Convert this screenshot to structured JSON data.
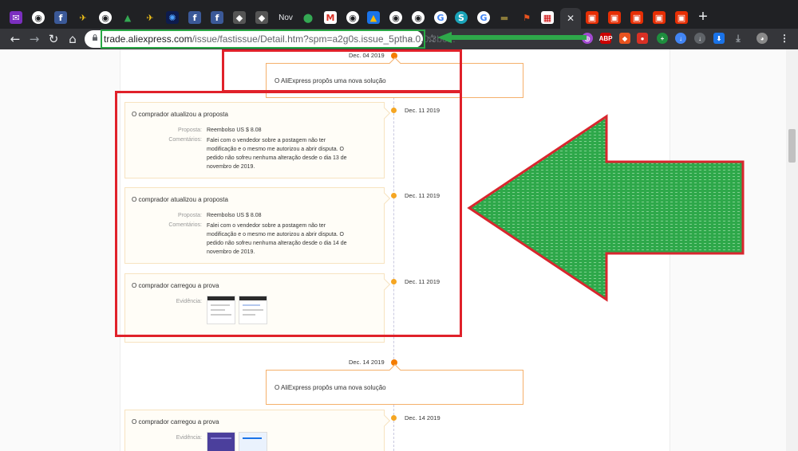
{
  "browser": {
    "url_host": "trade.aliexpress.com",
    "url_path": "/issue/fastissue/Detail.htm?spm=a2g0s.issue_5ptha.0.0.3b6...",
    "tab_nov_label": "Nov"
  },
  "timeline": {
    "system_events": [
      {
        "date": "Dec. 04 2019",
        "text": "O AliExpress propôs uma nova solução"
      },
      {
        "date": "Dec. 14 2019",
        "text": "O AliExpress propôs uma nova solução"
      }
    ],
    "buyer_events": [
      {
        "date": "Dec. 11 2019",
        "title": "O comprador atualizou a proposta",
        "proposal_label": "Proposta:",
        "proposal_value": "Reembolso US $ 8.08",
        "comments_label": "Comentários:",
        "comments_lines": [
          "Falei com o vendedor sobre a postagem não ter",
          "modificação e o mesmo me autorizou a abrir disputa. O",
          "pedido não sofreu nenhuma alteração desde o dia 13 de",
          "novembro de 2019."
        ]
      },
      {
        "date": "Dec. 11 2019",
        "title": "O comprador atualizou a proposta",
        "proposal_label": "Proposta:",
        "proposal_value": "Reembolso US $ 8.08",
        "comments_label": "Comentários:",
        "comments_lines": [
          "Falei com o vendedor sobre a postagem não ter",
          "modificação e o mesmo me autorizou a abrir disputa. O",
          "pedido não sofreu nenhuma alteração desde o dia 14 de",
          "novembro de 2019."
        ]
      },
      {
        "date": "Dec. 11 2019",
        "title": "O comprador carregou a prova",
        "evidence_label": "Evidência:"
      },
      {
        "date": "Dec. 14 2019",
        "title": "O comprador carregou a prova",
        "evidence_label": "Evidência:"
      }
    ]
  },
  "annotations": {
    "highlight_color": "#e0212a",
    "arrow_color": "#2ea84a",
    "url_highlight_color": "#29a745"
  },
  "extensions": {
    "abp_label": "ABP"
  }
}
